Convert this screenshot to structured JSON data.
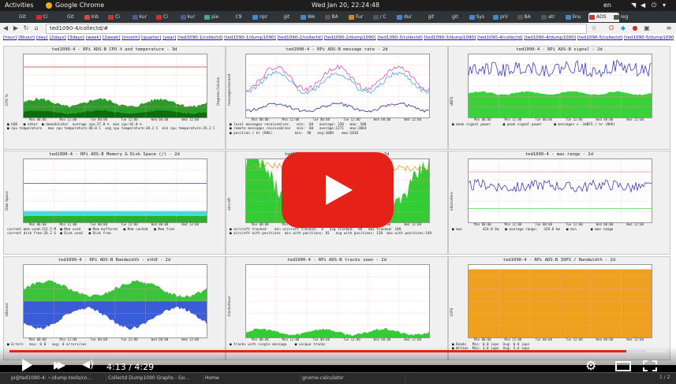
{
  "gnome": {
    "activities": "Activities",
    "app": "Google Chrome",
    "clock": "Wed Jan 20, 22:24:48",
    "lang": "en"
  },
  "tabs": [
    {
      "label": "Git",
      "color": "#333"
    },
    {
      "label": "Ci",
      "color": "#c33"
    },
    {
      "label": "Git",
      "color": "#333"
    },
    {
      "label": "Inb",
      "color": "#d44"
    },
    {
      "label": "Ci",
      "color": "#c33"
    },
    {
      "label": "kur",
      "color": "#558"
    },
    {
      "label": "Ci",
      "color": "#c33"
    },
    {
      "label": "kur",
      "color": "#558"
    },
    {
      "label": "pie",
      "color": "#4a8"
    },
    {
      "label": "C9",
      "color": "#333"
    },
    {
      "label": "npr",
      "color": "#48c"
    },
    {
      "label": "git",
      "color": "#333"
    },
    {
      "label": "We",
      "color": "#48c"
    },
    {
      "label": "BA",
      "color": "#555"
    },
    {
      "label": "Fur",
      "color": "#c83"
    },
    {
      "label": "/ C",
      "color": "#555"
    },
    {
      "label": "dur",
      "color": "#48c"
    },
    {
      "label": "git",
      "color": "#333"
    },
    {
      "label": "git",
      "color": "#333"
    },
    {
      "label": "Sys",
      "color": "#48c"
    },
    {
      "label": "prir",
      "color": "#48c"
    },
    {
      "label": "BA",
      "color": "#555"
    },
    {
      "label": "atr",
      "color": "#555"
    },
    {
      "label": "linu",
      "color": "#48c"
    },
    {
      "label": "ADS",
      "color": "#c33"
    },
    {
      "label": "reg",
      "color": "#555"
    }
  ],
  "toolbar": {
    "url": "ted1090-4/collectd/#"
  },
  "links": [
    "[hour]",
    "[6hour]",
    "[day]",
    "[2days]",
    "[3days]",
    "[week]",
    "[2week]",
    "[month]",
    "[quarter]",
    "[year]",
    "[ted1090-1/collectd]",
    "[ted1090-1/dump1090]",
    "[ted1090-2/collectd]",
    "[ted1090-2/dump1090]",
    "[ted1090-3/collectd]",
    "[ted1090-3/dump1090]",
    "[ted1090-4/collectd]",
    "[ted1090-4/dump1090]",
    "[ted1090-5/collectd]",
    "[ted1090-5/dump1090]"
  ],
  "panels": [
    {
      "title": "ted1090-4 - RPi ADS-B CPU % and temperature - 3d",
      "ylabel": "CPU %",
      "y2label": "Degrees Celsius",
      "legend": "■ USB   ■ other  ■ demodulator  average cpu:27.8 %  max cpu:92.0 %\n■ cpu temperature   max cpu temperature:48.0 C  avg cpu temperature:38.2 C  min cpu temperature:35.2 C"
    },
    {
      "title": "ted1090-4 - RPi ADS-B message rate - 2d",
      "ylabel": "messages/second",
      "y2label": "",
      "legend": "■ local messages received/sec    min:  68   average: 220   max: 500\n■ remote messages received/sec   min:  88   average:1271   max:2064\n■ position / hr (RHS)           min:  98   avg:1009    max:1818"
    },
    {
      "title": "ted1090-4 - RPi ADS-B signal - 2d",
      "ylabel": "dBFS",
      "y2label": "",
      "legend": "■ mean signal power      ■ peak signal power      ■ messages > -3dBFS / hr (RHS)"
    },
    {
      "title": "ted1090-4 - RPi ADS-B Memory & Disk Space (/) - 2d",
      "ylabel": "Disk Space",
      "y2label": "",
      "legend": "current mem used:152.5 M  ■ Mem used    ■ Mem buffered   ■ Mem cached   ■ Mem free\ncurrent disk free:26.2 G  ■ Disk used   ■ Disk free"
    },
    {
      "title": "ted1090-4 - RPi ADS-B aircraft seen - 2d",
      "ylabel": "aircraft",
      "y2label": "",
      "legend": "■ aircraft tracked    min aircraft tracked:  0   avg tracked:  98   max tracked: 189\n■ aircraft with positions  min with positions: 81   avg with positions: 128  max with positions:149"
    },
    {
      "title": "ted1090-4 - max range - 2d",
      "ylabel": "kilometers",
      "y2label": "",
      "legend": "■ max          424.0 km   ■ average range:   329.6 km   ■ min       ■ max range"
    },
    {
      "title": "ted1090-4 - RPi ADS-B Bandwidth - eth0 - 2d",
      "ylabel": "bits/sec",
      "y2label": "",
      "legend": "■ Errors   max: 0 B   avg: 0 errors/sec"
    },
    {
      "title": "ted1090-4 - RPi ADS-B tracks seen - 2d",
      "ylabel": "tracks/hour",
      "y2label": "",
      "legend": "■ tracks with single message    ■ unique tracks"
    },
    {
      "title": "ted1090-4 - RPi ADS-B IOPS / Bandwidth - 2d",
      "ylabel": "IOPS",
      "y2label": "",
      "legend": "■ Reads   Min: 0.0 iops  Avg: 0.0 iops\n■ Writes  Min: 3.6 iops  Avg: 5.4 iops"
    }
  ],
  "xticks": [
    "Mon 00:00",
    "Mon 12:00",
    "Tue 00:00",
    "Tue 12:00",
    "Wed 00:00",
    "Wed 12:00"
  ],
  "video": {
    "time": "4:13 / 4:29",
    "progress": 0.94,
    "loaded": 0.97
  },
  "taskbar": [
    {
      "label": "pi@ted1090-4: ~/dump-tools/co..."
    },
    {
      "label": "Collectd Dump1090 Graphs - Go..."
    },
    {
      "label": "Home"
    },
    {
      "label": "gnome-calculator"
    }
  ],
  "pager": "1 / 2"
}
